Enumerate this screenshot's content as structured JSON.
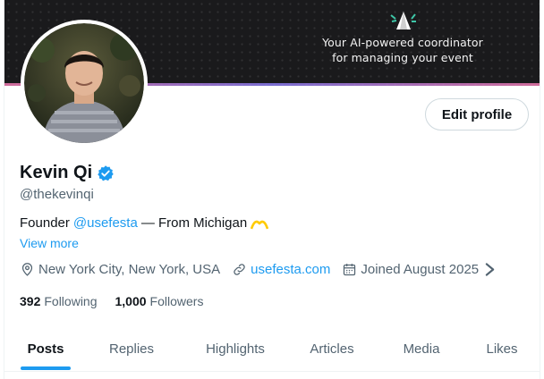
{
  "banner": {
    "tagline_line1": "Your AI-powered coordinator",
    "tagline_line2": "for managing your event"
  },
  "profile": {
    "name": "Kevin Qi",
    "verified": true,
    "handle": "@thekevinqi",
    "edit_button": "Edit profile",
    "bio": {
      "prefix": "Founder",
      "mention": "@usefesta",
      "suffix": "— From Michigan"
    },
    "view_more": "View more",
    "location": "New York City, New York, USA",
    "website": "usefesta.com",
    "joined": "Joined August 2025",
    "following_count": "392",
    "following_label": "Following",
    "followers_count": "1,000",
    "followers_label": "Followers"
  },
  "tabs": [
    {
      "label": "Posts",
      "active": true
    },
    {
      "label": "Replies",
      "active": false
    },
    {
      "label": "Highlights",
      "active": false
    },
    {
      "label": "Articles",
      "active": false
    },
    {
      "label": "Media",
      "active": false
    },
    {
      "label": "Likes",
      "active": false
    }
  ],
  "colors": {
    "accent": "#1d9bf0",
    "text_primary": "#0f1419",
    "text_secondary": "#536471",
    "banner_bg": "#1a1a1c",
    "michigan_maize": "#ffcb05"
  },
  "icons": [
    "verified-badge-icon",
    "location-pin-icon",
    "link-icon",
    "calendar-icon",
    "chevron-right-icon",
    "festa-logo-icon",
    "michigan-arches-icon"
  ]
}
